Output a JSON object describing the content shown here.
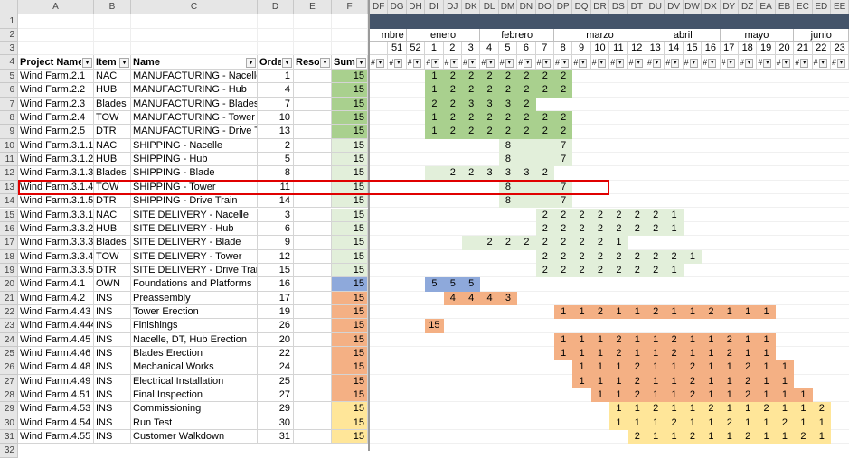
{
  "col_letters_left": [
    "A",
    "B",
    "C",
    "D",
    "E",
    "F"
  ],
  "col_letters_right": [
    "DF",
    "DG",
    "DH",
    "DI",
    "DJ",
    "DK",
    "DL",
    "DM",
    "DN",
    "DO",
    "DP",
    "DQ",
    "DR",
    "DS",
    "DT",
    "DU",
    "DV",
    "DW",
    "DX",
    "DY",
    "DZ",
    "EA",
    "EB",
    "EC",
    "ED",
    "EE"
  ],
  "row_numbers": [
    "1",
    "2",
    "3",
    "4",
    "5",
    "6",
    "7",
    "8",
    "9",
    "10",
    "11",
    "12",
    "13",
    "14",
    "15",
    "16",
    "17",
    "18",
    "19",
    "20",
    "21",
    "22",
    "23",
    "24",
    "25",
    "26",
    "27",
    "28",
    "29",
    "30",
    "31",
    "32"
  ],
  "months": [
    {
      "label": "mbre",
      "start": 0,
      "span": 2
    },
    {
      "label": "enero",
      "start": 2,
      "span": 4
    },
    {
      "label": "febrero",
      "start": 6,
      "span": 4
    },
    {
      "label": "marzo",
      "start": 10,
      "span": 5
    },
    {
      "label": "abril",
      "start": 15,
      "span": 4
    },
    {
      "label": "mayo",
      "start": 19,
      "span": 4
    },
    {
      "label": "junio",
      "start": 23,
      "span": 3
    }
  ],
  "weeks": [
    "",
    "51",
    "52",
    "1",
    "2",
    "3",
    "4",
    "5",
    "6",
    "7",
    "8",
    "9",
    "10",
    "11",
    "12",
    "13",
    "14",
    "15",
    "16",
    "17",
    "18",
    "19",
    "20",
    "21",
    "22",
    "23"
  ],
  "filter_glyph": "#",
  "headers": {
    "project": "Project Name / W",
    "item": "Item",
    "name": "Name",
    "order": "Orde",
    "resource": "Resour",
    "sum": "Sum"
  },
  "colors": {
    "green_dark": "#a9d08e",
    "green_light": "#e2efda",
    "blue": "#8ea9db",
    "orange": "#f4b084",
    "yellow": "#ffe699"
  },
  "rows": [
    {
      "project": "Wind Farm.2.1",
      "item": "NAC",
      "name": "MANUFACTURING - Nacelle",
      "order": "1",
      "sum": "15",
      "color": "green_dark",
      "gstart": 3,
      "gvals": [
        "1",
        "2",
        "2",
        "2",
        "2",
        "2",
        "2",
        "2"
      ]
    },
    {
      "project": "Wind Farm.2.2",
      "item": "HUB",
      "name": "MANUFACTURING - Hub",
      "order": "4",
      "sum": "15",
      "color": "green_dark",
      "gstart": 3,
      "gvals": [
        "1",
        "2",
        "2",
        "2",
        "2",
        "2",
        "2",
        "2"
      ]
    },
    {
      "project": "Wind Farm.2.3",
      "item": "Blades",
      "name": "MANUFACTURING - Blades",
      "order": "7",
      "sum": "15",
      "color": "green_dark",
      "gstart": 3,
      "gvals": [
        "2",
        "2",
        "3",
        "3",
        "3",
        "2"
      ]
    },
    {
      "project": "Wind Farm.2.4",
      "item": "TOW",
      "name": "MANUFACTURING - Tower",
      "order": "10",
      "sum": "15",
      "color": "green_dark",
      "gstart": 3,
      "gvals": [
        "1",
        "2",
        "2",
        "2",
        "2",
        "2",
        "2",
        "2"
      ]
    },
    {
      "project": "Wind Farm.2.5",
      "item": "DTR",
      "name": "MANUFACTURING - Drive Tra",
      "order": "13",
      "sum": "15",
      "color": "green_dark",
      "gstart": 3,
      "gvals": [
        "1",
        "2",
        "2",
        "2",
        "2",
        "2",
        "2",
        "2"
      ]
    },
    {
      "project": "Wind Farm.3.1.1",
      "item": "NAC",
      "name": "SHIPPING - Nacelle",
      "order": "2",
      "sum": "15",
      "color": "green_light",
      "gstart": 7,
      "gvals": [
        "8",
        "",
        "",
        "7"
      ]
    },
    {
      "project": "Wind Farm.3.1.2",
      "item": "HUB",
      "name": "SHIPPING - Hub",
      "order": "5",
      "sum": "15",
      "color": "green_light",
      "gstart": 7,
      "gvals": [
        "8",
        "",
        "",
        "7"
      ]
    },
    {
      "project": "Wind Farm.3.1.3",
      "item": "Blades",
      "name": "SHIPPING - Blade",
      "order": "8",
      "sum": "15",
      "color": "green_light",
      "gstart": 3,
      "gvals": [
        "",
        "2",
        "2",
        "3",
        "3",
        "3",
        "2"
      ]
    },
    {
      "project": "Wind Farm.3.1.4",
      "item": "TOW",
      "name": "SHIPPING - Tower",
      "order": "11",
      "sum": "15",
      "color": "green_light",
      "gstart": 7,
      "gvals": [
        "8",
        "",
        "",
        "7"
      ]
    },
    {
      "project": "Wind Farm.3.1.5",
      "item": "DTR",
      "name": "SHIPPING - Drive Train",
      "order": "14",
      "sum": "15",
      "color": "green_light",
      "gstart": 7,
      "gvals": [
        "8",
        "",
        "",
        "7"
      ]
    },
    {
      "project": "Wind Farm.3.3.1",
      "item": "NAC",
      "name": "SITE DELIVERY - Nacelle",
      "order": "3",
      "sum": "15",
      "color": "green_light",
      "gstart": 9,
      "gvals": [
        "2",
        "2",
        "2",
        "2",
        "2",
        "2",
        "2",
        "1"
      ]
    },
    {
      "project": "Wind Farm.3.3.2",
      "item": "HUB",
      "name": "SITE DELIVERY - Hub",
      "order": "6",
      "sum": "15",
      "color": "green_light",
      "gstart": 9,
      "gvals": [
        "2",
        "2",
        "2",
        "2",
        "2",
        "2",
        "2",
        "1"
      ]
    },
    {
      "project": "Wind Farm.3.3.3",
      "item": "Blades",
      "name": "SITE DELIVERY - Blade",
      "order": "9",
      "sum": "15",
      "color": "green_light",
      "gstart": 5,
      "gvals": [
        "",
        "2",
        "2",
        "2",
        "2",
        "2",
        "2",
        "2",
        "1"
      ]
    },
    {
      "project": "Wind Farm.3.3.4",
      "item": "TOW",
      "name": "SITE DELIVERY - Tower",
      "order": "12",
      "sum": "15",
      "color": "green_light",
      "gstart": 9,
      "gvals": [
        "2",
        "2",
        "2",
        "2",
        "2",
        "2",
        "2",
        "2",
        "1"
      ]
    },
    {
      "project": "Wind Farm.3.3.5",
      "item": "DTR",
      "name": "SITE DELIVERY - Drive Train",
      "order": "15",
      "sum": "15",
      "color": "green_light",
      "gstart": 9,
      "gvals": [
        "2",
        "2",
        "2",
        "2",
        "2",
        "2",
        "2",
        "1"
      ]
    },
    {
      "project": "Wind Farm.4.1",
      "item": "OWN",
      "name": "Foundations and Platforms",
      "order": "16",
      "sum": "15",
      "color": "blue",
      "gstart": 3,
      "gvals": [
        "5",
        "5",
        "5"
      ]
    },
    {
      "project": "Wind Farm.4.2",
      "item": "INS",
      "name": "Preassembly",
      "order": "17",
      "sum": "15",
      "color": "orange",
      "gstart": 4,
      "gvals": [
        "4",
        "4",
        "4",
        "3"
      ]
    },
    {
      "project": "Wind Farm.4.43",
      "item": "INS",
      "name": "Tower Erection",
      "order": "19",
      "sum": "15",
      "color": "orange",
      "gstart": 10,
      "gvals": [
        "1",
        "1",
        "2",
        "1",
        "1",
        "2",
        "1",
        "1",
        "2",
        "1",
        "1",
        "1"
      ]
    },
    {
      "project": "Wind Farm.4.444",
      "item": "INS",
      "name": "Finishings",
      "order": "26",
      "sum": "15",
      "color": "orange",
      "gstart": 3,
      "gvals": [
        "15"
      ]
    },
    {
      "project": "Wind Farm.4.45",
      "item": "INS",
      "name": "Nacelle, DT, Hub Erection",
      "order": "20",
      "sum": "15",
      "color": "orange",
      "gstart": 10,
      "gvals": [
        "1",
        "1",
        "1",
        "2",
        "1",
        "1",
        "2",
        "1",
        "1",
        "2",
        "1",
        "1"
      ]
    },
    {
      "project": "Wind Farm.4.46",
      "item": "INS",
      "name": "Blades Erection",
      "order": "22",
      "sum": "15",
      "color": "orange",
      "gstart": 10,
      "gvals": [
        "1",
        "1",
        "1",
        "2",
        "1",
        "1",
        "2",
        "1",
        "1",
        "2",
        "1",
        "1"
      ]
    },
    {
      "project": "Wind Farm.4.48",
      "item": "INS",
      "name": "Mechanical Works",
      "order": "24",
      "sum": "15",
      "color": "orange",
      "gstart": 11,
      "gvals": [
        "1",
        "1",
        "1",
        "2",
        "1",
        "1",
        "2",
        "1",
        "1",
        "2",
        "1",
        "1"
      ]
    },
    {
      "project": "Wind Farm.4.49",
      "item": "INS",
      "name": "Electrical Installation",
      "order": "25",
      "sum": "15",
      "color": "orange",
      "gstart": 11,
      "gvals": [
        "1",
        "1",
        "1",
        "2",
        "1",
        "1",
        "2",
        "1",
        "1",
        "2",
        "1",
        "1"
      ]
    },
    {
      "project": "Wind Farm.4.51",
      "item": "INS",
      "name": "Final Inspection",
      "order": "27",
      "sum": "15",
      "color": "orange",
      "gstart": 12,
      "gvals": [
        "1",
        "1",
        "2",
        "1",
        "1",
        "2",
        "1",
        "1",
        "2",
        "1",
        "1",
        "1"
      ]
    },
    {
      "project": "Wind Farm.4.53",
      "item": "INS",
      "name": "Commissioning",
      "order": "29",
      "sum": "15",
      "color": "yellow",
      "gstart": 13,
      "gvals": [
        "1",
        "1",
        "2",
        "1",
        "1",
        "2",
        "1",
        "1",
        "2",
        "1",
        "1",
        "2"
      ]
    },
    {
      "project": "Wind Farm.4.54",
      "item": "INS",
      "name": "Run Test",
      "order": "30",
      "sum": "15",
      "color": "yellow",
      "gstart": 13,
      "gvals": [
        "1",
        "1",
        "1",
        "2",
        "1",
        "1",
        "2",
        "1",
        "1",
        "2",
        "1",
        "1"
      ]
    },
    {
      "project": "Wind Farm.4.55",
      "item": "INS",
      "name": "Customer Walkdown",
      "order": "31",
      "sum": "15",
      "color": "yellow",
      "gstart": 14,
      "gvals": [
        "2",
        "1",
        "1",
        "2",
        "1",
        "1",
        "2",
        "1",
        "1",
        "2",
        "1"
      ]
    }
  ]
}
